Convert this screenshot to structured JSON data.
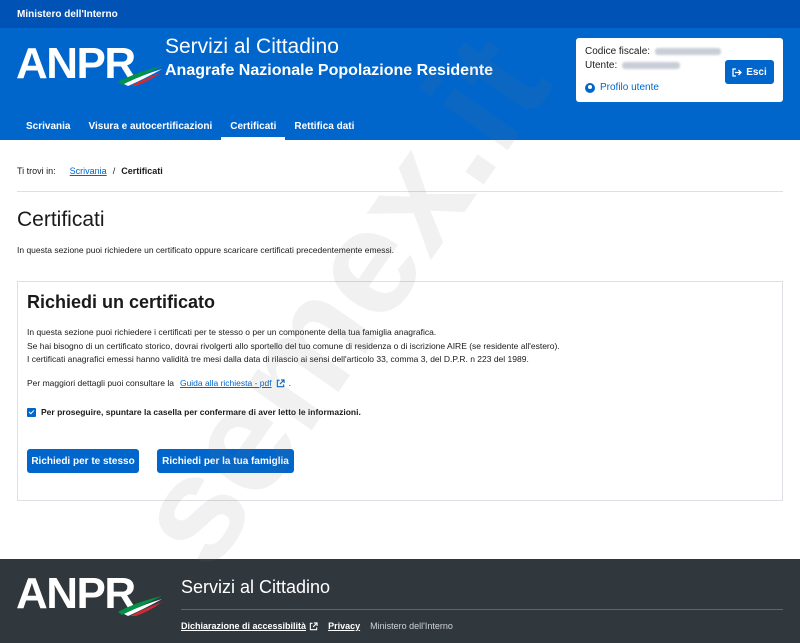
{
  "top_bar": {
    "ministry": "Ministero dell'Interno"
  },
  "header": {
    "logo_text": "ANPR",
    "title": "Servizi al Cittadino",
    "subtitle": "Anagrafe Nazionale Popolazione Residente"
  },
  "user_box": {
    "fiscal_code_label": "Codice fiscale:",
    "user_label": "Utente:",
    "profile_label": "Profilo utente",
    "exit_label": "Esci"
  },
  "nav": {
    "items": [
      {
        "label": "Scrivania",
        "active": false
      },
      {
        "label": "Visura e autocertificazioni",
        "active": false
      },
      {
        "label": "Certificati",
        "active": true
      },
      {
        "label": "Rettifica dati",
        "active": false
      }
    ]
  },
  "breadcrumb": {
    "prefix": "Ti trovi in:",
    "home": "Scrivania",
    "separator": "/",
    "current": "Certificati"
  },
  "main": {
    "title": "Certificati",
    "description": "In questa sezione puoi richiedere un certificato oppure scaricare certificati precedentemente emessi."
  },
  "request_card": {
    "title": "Richiedi un certificato",
    "lines": [
      "In questa sezione puoi richiedere i certificati per te stesso o per un componente della tua famiglia anagrafica.",
      "Se hai bisogno di un certificato storico, dovrai rivolgerti allo sportello del tuo comune di residenza o di iscrizione AIRE (se residente all'estero).",
      "I certificati anagrafici emessi hanno validità tre mesi dalla data di rilascio ai sensi dell'articolo 33, comma 3, del D.P.R. n 223 del 1989."
    ],
    "guide_prefix": "Per maggiori dettagli puoi consultare la",
    "guide_link": "Guida alla richiesta - pdf",
    "guide_suffix": ".",
    "confirm_label": "Per proseguire, spuntare la casella per confermare di aver letto le informazioni.",
    "confirm_checked": true,
    "button_self": "Richiedi per te stesso",
    "button_family": "Richiedi per la tua famiglia"
  },
  "footer": {
    "logo_text": "ANPR",
    "title": "Servizi al Cittadino",
    "accessibility_link": "Dichiarazione di accessibilità",
    "privacy_link": "Privacy",
    "ministry": "Ministero dell'Interno"
  },
  "watermark": {
    "text": "semex.it"
  },
  "colors": {
    "primary": "#0066cc",
    "top_bar": "#0052b4",
    "footer": "#30373d",
    "flag_green": "#009246",
    "flag_red": "#ce2b37"
  }
}
